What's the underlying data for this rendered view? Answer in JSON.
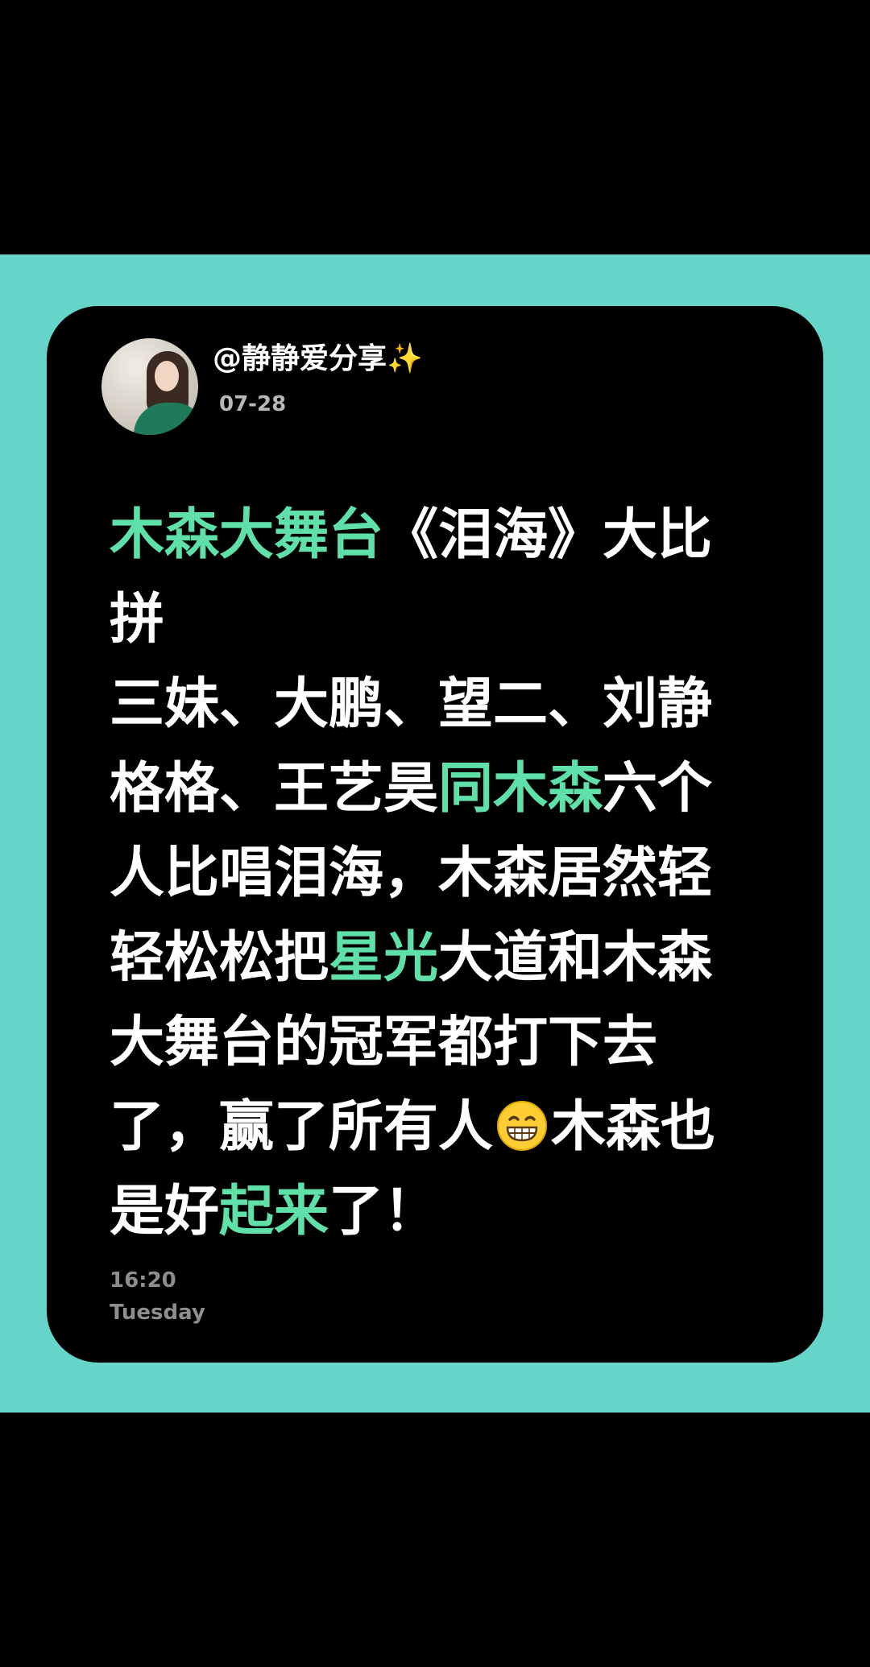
{
  "post": {
    "username": "@静静爱分享",
    "sparkle_icon": "✨",
    "date": "07-28",
    "body_lines": [
      [
        {
          "t": "木森大舞台",
          "hl": true
        },
        {
          "t": "《泪海》大比",
          "hl": false
        }
      ],
      [
        {
          "t": "拼",
          "hl": false
        }
      ],
      [
        {
          "t": "三妹、大鹏、望二、刘静",
          "hl": false
        }
      ],
      [
        {
          "t": "格格、王艺昊",
          "hl": false
        },
        {
          "t": "同木森",
          "hl": true
        },
        {
          "t": "六个",
          "hl": false
        }
      ],
      [
        {
          "t": "人比唱泪海，木森居然轻",
          "hl": false
        }
      ],
      [
        {
          "t": "轻松松把",
          "hl": false
        },
        {
          "t": "星光",
          "hl": true
        },
        {
          "t": "大道和木森",
          "hl": false
        }
      ],
      [
        {
          "t": "大舞台的冠军都打下去",
          "hl": false
        }
      ],
      [
        {
          "t": "了，赢了所有人",
          "hl": false
        },
        {
          "emoji": "grinning-face-icon"
        },
        {
          "t": "木森也",
          "hl": false
        }
      ],
      [
        {
          "t": "是好",
          "hl": false
        },
        {
          "t": "起来",
          "hl": true
        },
        {
          "t": "了！",
          "hl": false
        }
      ]
    ],
    "footer_time": "16:20",
    "footer_day": "Tuesday"
  },
  "colors": {
    "background": "#000000",
    "band": "#67d4ca",
    "card": "#000000",
    "highlight": "#5fe0a8",
    "text": "#ffffff",
    "muted": "#8e8e8e"
  }
}
